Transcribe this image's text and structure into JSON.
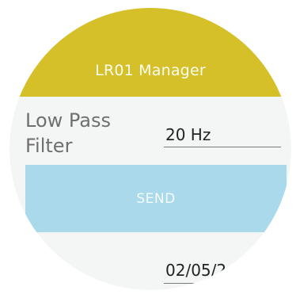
{
  "app": {
    "title": "LR01 Manager"
  },
  "filter": {
    "label": "Low Pass\nFilter",
    "value": "20 Hz"
  },
  "actions": {
    "send_label": "SEND"
  },
  "date": {
    "value": "02/05/2"
  },
  "colors": {
    "header": "#d6c02a",
    "send_button": "#a9d9ea",
    "background": "#f4f6f6"
  }
}
